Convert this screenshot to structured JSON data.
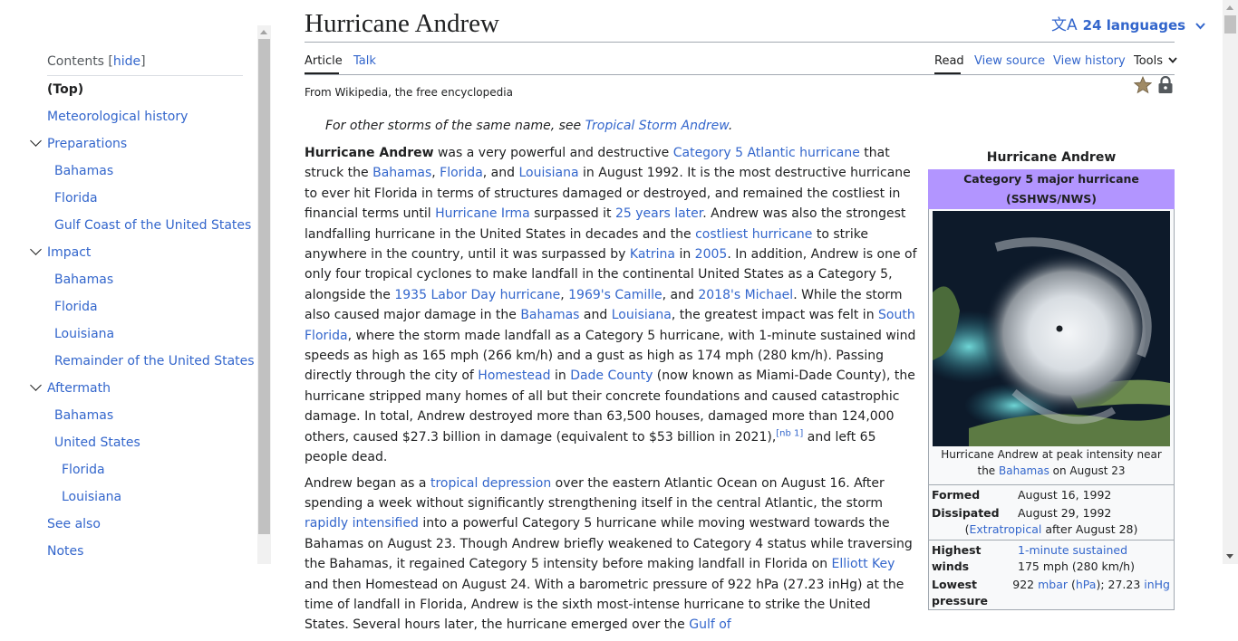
{
  "toc": {
    "heading": "Contents",
    "hide_label": "hide",
    "items": [
      {
        "label": "(Top)"
      },
      {
        "label": "Meteorological history"
      },
      {
        "label": "Preparations"
      },
      {
        "label": "Bahamas"
      },
      {
        "label": "Florida"
      },
      {
        "label": "Gulf Coast of the United States"
      },
      {
        "label": "Impact"
      },
      {
        "label": "Bahamas"
      },
      {
        "label": "Florida"
      },
      {
        "label": "Louisiana"
      },
      {
        "label": "Remainder of the United States"
      },
      {
        "label": "Aftermath"
      },
      {
        "label": "Bahamas"
      },
      {
        "label": "United States"
      },
      {
        "label": "Florida"
      },
      {
        "label": "Louisiana"
      },
      {
        "label": "See also"
      },
      {
        "label": "Notes"
      }
    ]
  },
  "page": {
    "title": "Hurricane Andrew",
    "languages": "24 languages",
    "tagline": "From Wikipedia, the free encyclopedia"
  },
  "tabs": {
    "article": "Article",
    "talk": "Talk",
    "read": "Read",
    "view_source": "View source",
    "view_history": "View history",
    "tools": "Tools"
  },
  "hatnote": {
    "prefix": "For other storms of the same name, see ",
    "link": "Tropical Storm Andrew",
    "suffix": "."
  },
  "article": {
    "p1": [
      {
        "t": "Hurricane Andrew",
        "b": true
      },
      {
        "t": " was a very powerful and destructive "
      },
      {
        "t": "Category 5 Atlantic hurricane",
        "l": true
      },
      {
        "t": " that struck the "
      },
      {
        "t": "Bahamas",
        "l": true
      },
      {
        "t": ", "
      },
      {
        "t": "Florida",
        "l": true
      },
      {
        "t": ", and "
      },
      {
        "t": "Louisiana",
        "l": true
      },
      {
        "t": " in August 1992. It is the most destructive hurricane to ever hit Florida in terms of structures damaged or destroyed, and remained the costliest in financial terms until "
      },
      {
        "t": "Hurricane Irma",
        "l": true
      },
      {
        "t": " surpassed it "
      },
      {
        "t": "25 years later",
        "l": true
      },
      {
        "t": ". Andrew was also the strongest landfalling hurricane in the United States in decades and the "
      },
      {
        "t": "costliest hurricane",
        "l": true
      },
      {
        "t": " to strike anywhere in the country, until it was surpassed by "
      },
      {
        "t": "Katrina",
        "l": true
      },
      {
        "t": " in "
      },
      {
        "t": "2005",
        "l": true
      },
      {
        "t": ". In addition, Andrew is one of only four tropical cyclones to make landfall in the continental United States as a Category 5, alongside the "
      },
      {
        "t": "1935 Labor Day hurricane",
        "l": true
      },
      {
        "t": ", "
      },
      {
        "t": "1969's Camille",
        "l": true
      },
      {
        "t": ", and "
      },
      {
        "t": "2018's Michael",
        "l": true
      },
      {
        "t": ". While the storm also caused major damage in the "
      },
      {
        "t": "Bahamas",
        "l": true
      },
      {
        "t": " and "
      },
      {
        "t": "Louisiana",
        "l": true
      },
      {
        "t": ", the greatest impact was felt in "
      },
      {
        "t": "South Florida",
        "l": true
      },
      {
        "t": ", where the storm made landfall as a Category 5 hurricane, with 1-minute sustained wind speeds as high as 165 mph (266 km/h) and a gust as high as 174 mph (280 km/h). Passing directly through the city of "
      },
      {
        "t": "Homestead",
        "l": true
      },
      {
        "t": " in "
      },
      {
        "t": "Dade County",
        "l": true
      },
      {
        "t": " (now known as Miami-Dade County), the hurricane stripped many homes of all but their concrete foundations and caused catastrophic damage. In total, Andrew destroyed more than 63,500 houses, damaged more than 124,000 others, caused $27.3 billion in damage (equivalent to $53 billion in 2021),"
      },
      {
        "t": "[nb 1]",
        "sup": true
      },
      {
        "t": " and left 65 people dead."
      }
    ],
    "p2": [
      {
        "t": "Andrew began as a "
      },
      {
        "t": "tropical depression",
        "l": true
      },
      {
        "t": " over the eastern Atlantic Ocean on August 16. After spending a week without significantly strengthening itself in the central Atlantic, the storm "
      },
      {
        "t": "rapidly intensified",
        "l": true
      },
      {
        "t": " into a powerful Category 5 hurricane while moving westward towards the Bahamas on August 23. Though Andrew briefly weakened to Category 4 status while traversing the Bahamas, it regained Category 5 intensity before making landfall in Florida on "
      },
      {
        "t": "Elliott Key",
        "l": true
      },
      {
        "t": " and then Homestead on August 24. With a barometric pressure of 922 hPa (27.23 inHg) at the time of landfall in Florida, Andrew is the sixth most-intense hurricane to strike the United States. Several hours later, the hurricane emerged over the "
      },
      {
        "t": "Gulf of",
        "l": true
      }
    ]
  },
  "infobox": {
    "title": "Hurricane Andrew",
    "category": "Category 5 major hurricane (SSHWS/NWS)",
    "caption_prefix": "Hurricane Andrew at peak intensity near the ",
    "caption_link": "Bahamas",
    "caption_suffix": " on August 23",
    "formed_label": "Formed",
    "formed_value": "August 16, 1992",
    "dissipated_label": "Dissipated",
    "dissipated_value": "August 29, 1992",
    "extratropical_link": "Extratropical",
    "extratropical_suffix": " after August 28)",
    "winds_label": "Highest winds",
    "winds_link": "1-minute sustained",
    "winds_value": "175 mph (280 km/h)",
    "pressure_label": "Lowest pressure",
    "pressure_value": "922 ",
    "pressure_unit1": "mbar",
    "pressure_unit2": "hPa",
    "pressure_mid": "27.23 ",
    "pressure_unit3": "inHg"
  },
  "colors": {
    "link": "#3366cc",
    "category5": "#b295ff",
    "text": "#202122"
  }
}
